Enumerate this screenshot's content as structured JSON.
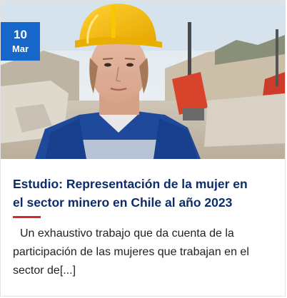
{
  "post": {
    "date": {
      "day": "10",
      "month": "Mar"
    },
    "title": "Estudio: Representación de la mujer en el sector minero en Chile al año 2023",
    "excerpt": "Un exhaustivo trabajo que da cuenta de la participación de las mujeres que trabajan en el sector de[...]",
    "image_alt": "woman-miner-photo"
  },
  "colors": {
    "badge": "#1766c9",
    "title": "#0c2d6b",
    "divider": "#d8262e",
    "text": "#222222"
  }
}
